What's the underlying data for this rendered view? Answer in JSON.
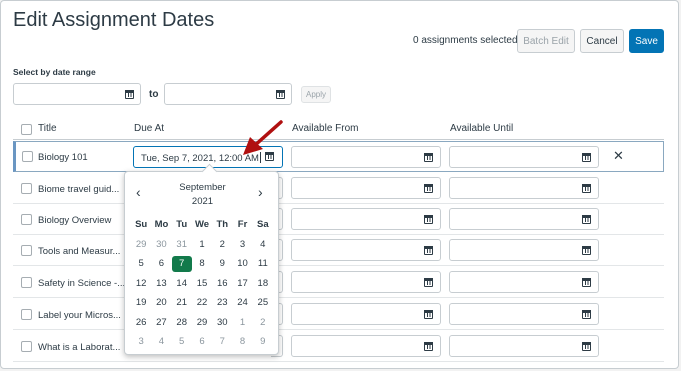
{
  "page": {
    "title": "Edit Assignment Dates",
    "selected_count": "0 assignments selected",
    "batch_edit": "Batch Edit",
    "cancel": "Cancel",
    "save": "Save",
    "range_label": "Select by date range",
    "to_label": "to",
    "apply": "Apply"
  },
  "columns": {
    "title": "Title",
    "due": "Due At",
    "from": "Available From",
    "until": "Available Until"
  },
  "rows": [
    {
      "title": "Biology 101"
    },
    {
      "title": "Biome travel guid..."
    },
    {
      "title": "Biology Overview"
    },
    {
      "title": "Tools and Measur..."
    },
    {
      "title": "Safety in Science -..."
    },
    {
      "title": "Label your Micros..."
    },
    {
      "title": "What is a Laborat..."
    }
  ],
  "active_due_value": "Tue, Sep 7, 2021, 12:00 AM",
  "calendar": {
    "month": "September",
    "year": "2021",
    "prev": "‹",
    "next": "›",
    "weekdays": [
      "Su",
      "Mo",
      "Tu",
      "We",
      "Th",
      "Fr",
      "Sa"
    ],
    "weeks": [
      [
        "29",
        "30",
        "31",
        "1",
        "2",
        "3",
        "4"
      ],
      [
        "5",
        "6",
        "7",
        "8",
        "9",
        "10",
        "11"
      ],
      [
        "12",
        "13",
        "14",
        "15",
        "16",
        "17",
        "18"
      ],
      [
        "19",
        "20",
        "21",
        "22",
        "23",
        "24",
        "25"
      ],
      [
        "26",
        "27",
        "28",
        "29",
        "30",
        "1",
        "2"
      ],
      [
        "3",
        "4",
        "5",
        "6",
        "7",
        "8",
        "9"
      ]
    ],
    "selected_day": "7"
  },
  "colors": {
    "primary": "#0374b5",
    "selected_day": "#127a4b",
    "arrow": "#b01010"
  }
}
